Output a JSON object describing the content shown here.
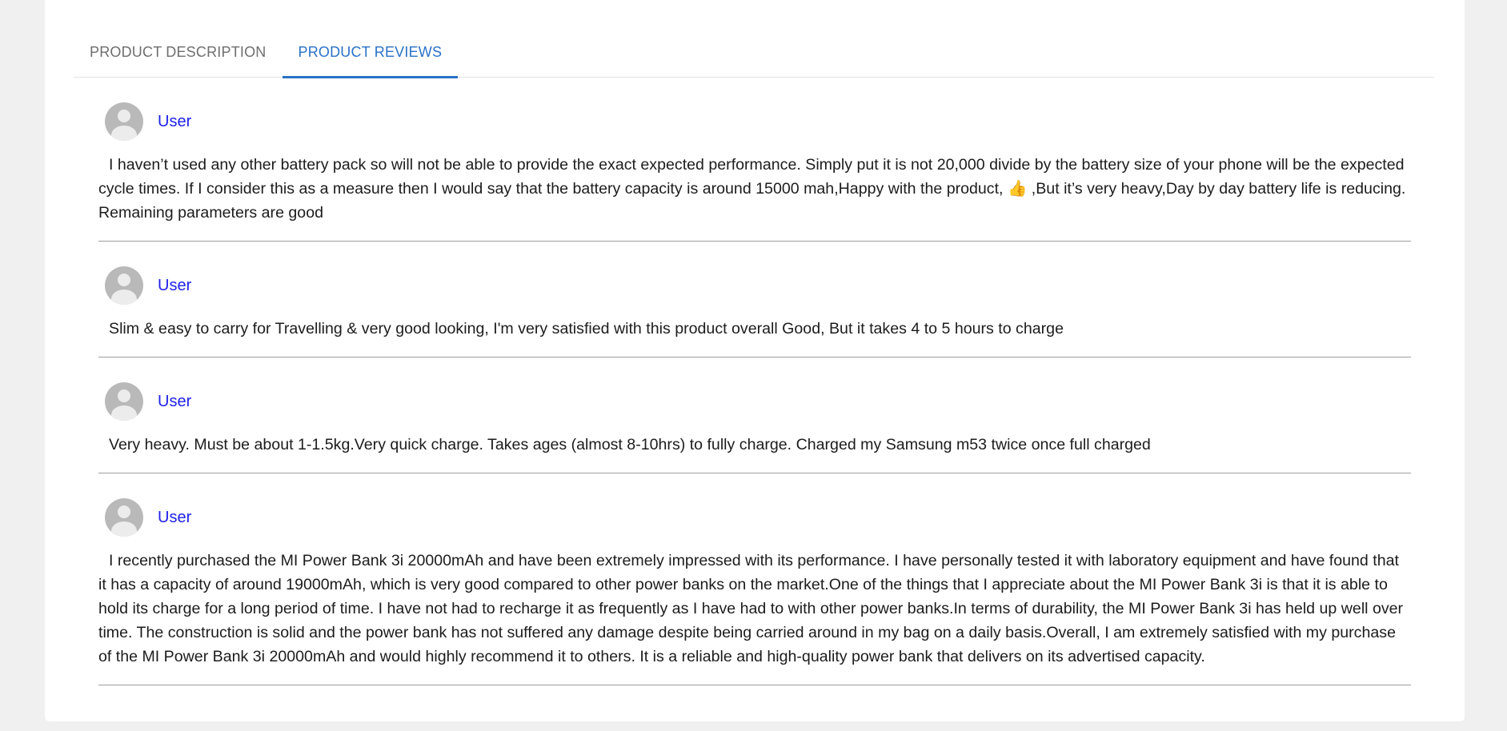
{
  "tabs": [
    {
      "label": "PRODUCT DESCRIPTION",
      "active": false
    },
    {
      "label": "PRODUCT REVIEWS",
      "active": true
    }
  ],
  "reviews": [
    {
      "user": "User",
      "text": "I haven’t used any other battery pack so will not be able to provide the exact expected performance. Simply put it is not 20,000 divide by the battery size of your phone will be the expected cycle times. If I consider this as a measure then I would say that the battery capacity is around 15000 mah,Happy with the product, 👍 ,But it’s very heavy,Day by day battery life is reducing. Remaining parameters are good"
    },
    {
      "user": "User",
      "text": "Slim & easy to carry for Travelling & very good looking, I'm very satisfied with this product overall Good, But it takes 4 to 5 hours to charge"
    },
    {
      "user": "User",
      "text": "Very heavy. Must be about 1-1.5kg.Very quick charge. Takes ages (almost 8-10hrs) to fully charge. Charged my Samsung m53 twice once full charged"
    },
    {
      "user": "User",
      "text": "I recently purchased the MI Power Bank 3i 20000mAh and have been extremely impressed with its performance. I have personally tested it with laboratory equipment and have found that it has a capacity of around 19000mAh, which is very good compared to other power banks on the market.One of the things that I appreciate about the MI Power Bank 3i is that it is able to hold its charge for a long period of time. I have not had to recharge it as frequently as I have had to with other power banks.In terms of durability, the MI Power Bank 3i has held up well over time. The construction is solid and the power bank has not suffered any damage despite being carried around in my bag on a daily basis.Overall, I am extremely satisfied with my purchase of the MI Power Bank 3i 20000mAh and would highly recommend it to others. It is a reliable and high-quality power bank that delivers on its advertised capacity."
    }
  ],
  "colors": {
    "accent": "#2a72c8",
    "user_link": "#1f22e8",
    "page_bg": "#f1f0f1"
  }
}
